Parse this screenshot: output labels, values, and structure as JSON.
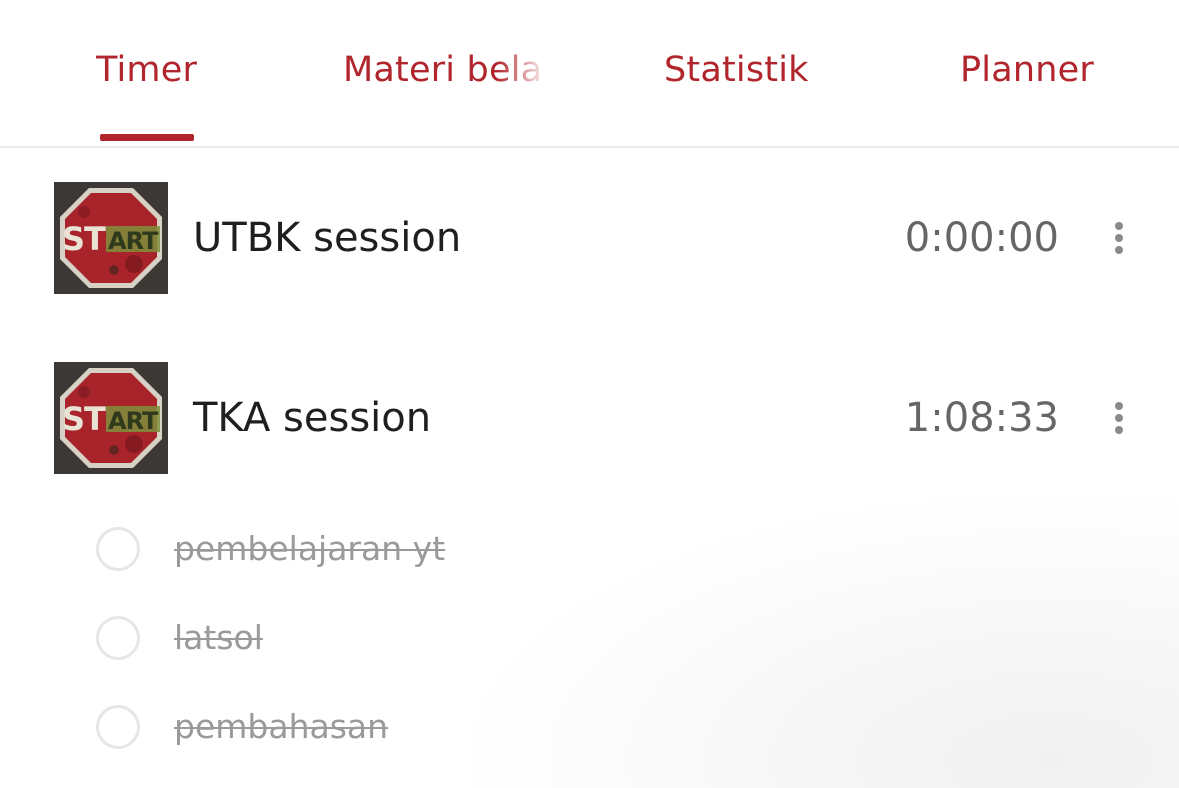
{
  "tabs": [
    {
      "label": "Timer",
      "active": true
    },
    {
      "label": "Materi belajar",
      "active": false
    },
    {
      "label": "Statistik",
      "active": false
    },
    {
      "label": "Planner",
      "active": false
    }
  ],
  "colors": {
    "accent": "#b1262c",
    "text_primary": "#1f1f1f",
    "text_time": "#666666",
    "text_done": "#9a9a9a",
    "divider": "#ededf0"
  },
  "sessions": [
    {
      "name": "UTBK session",
      "time": "0:00:00",
      "thumbnail_icon": "stop-start-sign-image",
      "menu_icon": "more-vertical-icon"
    },
    {
      "name": "TKA session",
      "time": "1:08:33",
      "thumbnail_icon": "stop-start-sign-image",
      "menu_icon": "more-vertical-icon"
    }
  ],
  "tasks": [
    {
      "label": "pembelajaran yt",
      "done": true
    },
    {
      "label": "latsol",
      "done": true
    },
    {
      "label": "pembahasan",
      "done": true
    }
  ]
}
